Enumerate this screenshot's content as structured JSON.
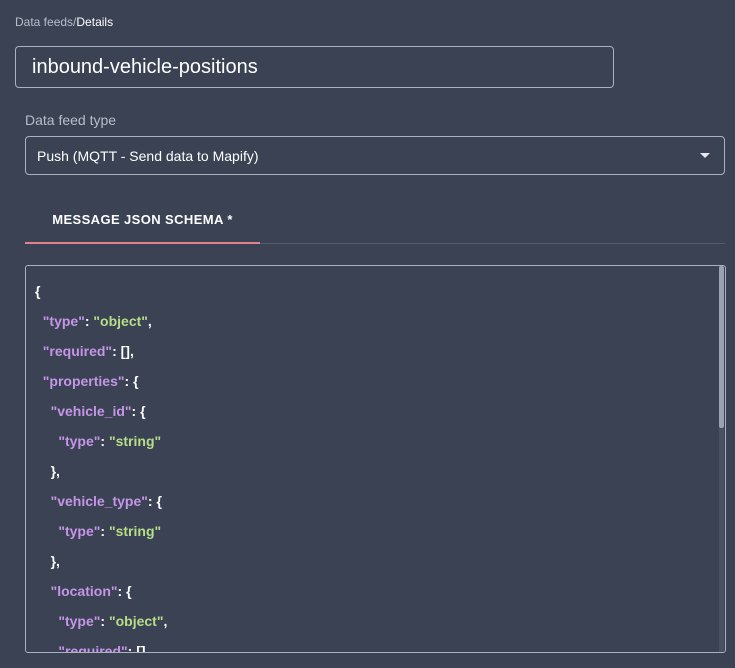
{
  "breadcrumb": {
    "parent": "Data feeds",
    "separator": "/",
    "current": "Details"
  },
  "name_field": {
    "value": "inbound-vehicle-positions"
  },
  "data_feed_type": {
    "label": "Data feed type",
    "selected": "Push (MQTT - Send data to Mapify)",
    "icon": "chevron-down-icon"
  },
  "tabs": [
    {
      "label": "MESSAGE JSON SCHEMA *",
      "active": true
    }
  ],
  "editor": {
    "lines": [
      {
        "indent": "",
        "key": "",
        "value": "",
        "punct": "{"
      },
      {
        "indent": "  ",
        "key": "\"type\"",
        "value": "\"object\"",
        "punct": ","
      },
      {
        "indent": "  ",
        "key": "\"required\"",
        "value": "",
        "punct": "[],"
      },
      {
        "indent": "  ",
        "key": "\"properties\"",
        "value": "",
        "punct": "{"
      },
      {
        "indent": "    ",
        "key": "\"vehicle_id\"",
        "value": "",
        "punct": "{"
      },
      {
        "indent": "      ",
        "key": "\"type\"",
        "value": "\"string\"",
        "punct": ""
      },
      {
        "indent": "    ",
        "key": "",
        "value": "",
        "punct": "},"
      },
      {
        "indent": "    ",
        "key": "\"vehicle_type\"",
        "value": "",
        "punct": "{"
      },
      {
        "indent": "      ",
        "key": "\"type\"",
        "value": "\"string\"",
        "punct": ""
      },
      {
        "indent": "    ",
        "key": "",
        "value": "",
        "punct": "},"
      },
      {
        "indent": "    ",
        "key": "\"location\"",
        "value": "",
        "punct": "{"
      },
      {
        "indent": "      ",
        "key": "\"type\"",
        "value": "\"object\"",
        "punct": ","
      },
      {
        "indent": "      ",
        "key": "\"required\"",
        "value": "",
        "punct": "[],"
      }
    ]
  },
  "colors": {
    "background": "#3a4254",
    "tab_indicator": "#e3818b",
    "json_key": "#c595e6",
    "json_string": "#b7dd87"
  }
}
